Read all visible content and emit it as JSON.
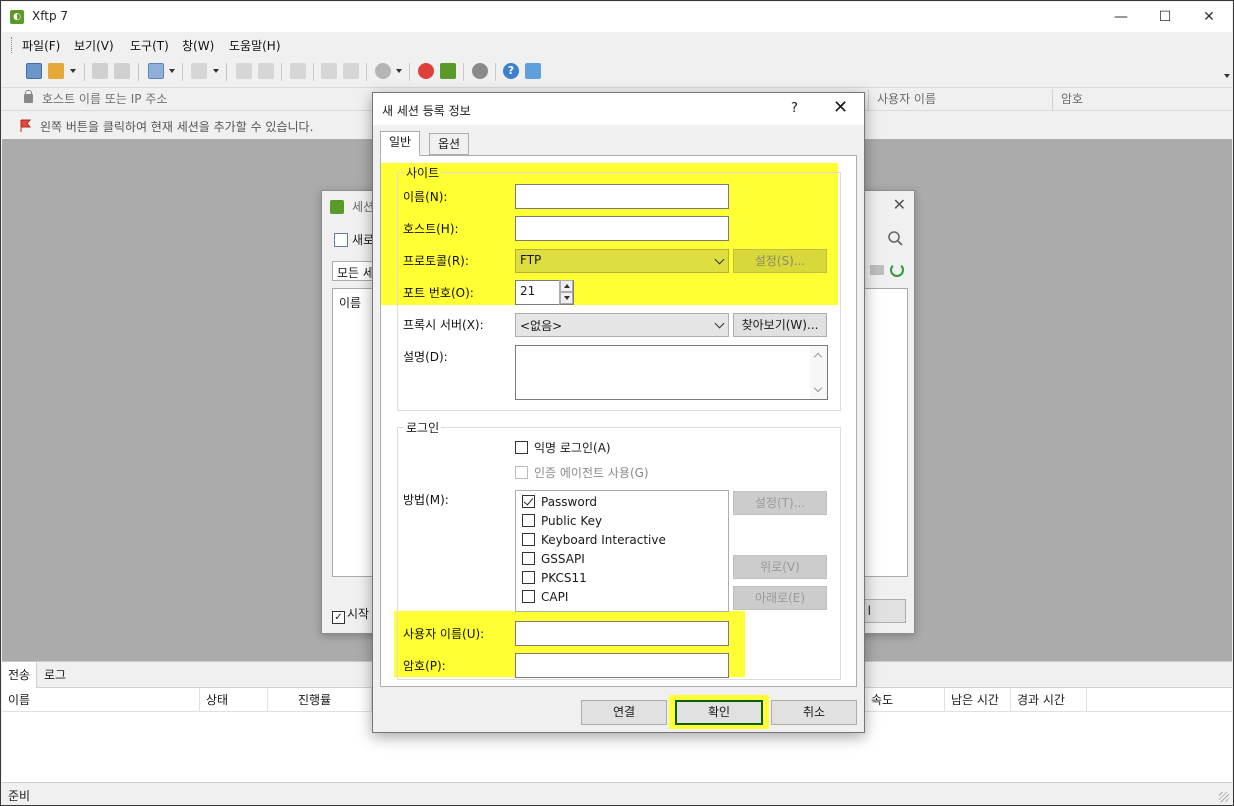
{
  "app": {
    "title": "Xftp 7",
    "icon": "xftp-logo-icon",
    "window_controls": {
      "minimize": "—",
      "maximize": "☐",
      "close": "✕"
    }
  },
  "menu": [
    "파일(F)",
    "보기(V)",
    "도구(T)",
    "창(W)",
    "도움말(H)"
  ],
  "address": {
    "host_placeholder": "호스트 이름 또는 IP 주소",
    "user_placeholder": "사용자 이름",
    "password_placeholder": "암호"
  },
  "hint": "왼쪽 버튼을 클릭하여 현재 세션을 추가할 수 있습니다.",
  "bg_dialog": {
    "title": "세션",
    "new_label": "새로",
    "tab": "모든 세",
    "list_header": "이름",
    "start_label": "시작",
    "button_label": "l"
  },
  "bottom": {
    "tabs": [
      "전송",
      "로그"
    ],
    "columns": [
      "이름",
      "상태",
      "진행률",
      "속도",
      "남은 시간",
      "경과 시간"
    ]
  },
  "status": "준비",
  "dialog": {
    "title": "새 세션 등록 정보",
    "help": "?",
    "close": "✕",
    "tabs": [
      "일반",
      "옵션"
    ],
    "site": {
      "legend": "사이트",
      "name_label": "이름(N):",
      "name_value": "",
      "host_label": "호스트(H):",
      "host_value": "",
      "protocol_label": "프로토콜(R):",
      "protocol_value": "FTP",
      "settings_button": "설정(S)...",
      "port_label": "포트 번호(O):",
      "port_value": "21",
      "proxy_label": "프록시 서버(X):",
      "proxy_value": "<없음>",
      "browse_button": "찾아보기(W)...",
      "desc_label": "설명(D):",
      "desc_value": ""
    },
    "login": {
      "legend": "로그인",
      "anonymous_label": "익명 로그인(A)",
      "anonymous_checked": false,
      "agent_label": "인증 에이전트 사용(G)",
      "agent_checked": false,
      "method_label": "방법(M):",
      "methods": [
        {
          "label": "Password",
          "checked": true
        },
        {
          "label": "Public Key",
          "checked": false
        },
        {
          "label": "Keyboard Interactive",
          "checked": false
        },
        {
          "label": "GSSAPI",
          "checked": false
        },
        {
          "label": "PKCS11",
          "checked": false
        },
        {
          "label": "CAPI",
          "checked": false
        }
      ],
      "method_settings_button": "설정(T)...",
      "up_button": "위로(V)",
      "down_button": "아래로(E)",
      "username_label": "사용자 이름(U):",
      "username_value": "",
      "password_label": "암호(P):",
      "password_value": ""
    },
    "buttons": {
      "connect": "연결",
      "ok": "확인",
      "cancel": "취소"
    }
  },
  "colors": {
    "highlight": "#ffff33",
    "ok_border": "#0b5d0b",
    "brand": "#5a9a28"
  }
}
